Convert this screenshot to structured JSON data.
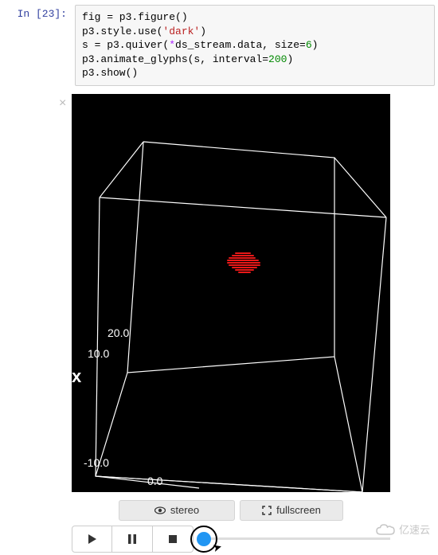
{
  "cell": {
    "prompt": "In [23]:",
    "code": {
      "line1": "fig = p3.figure()",
      "line2a": "p3.style.use(",
      "line2str": "'dark'",
      "line2b": ")",
      "line3a": "s = p3.quiver(",
      "line3op": "*",
      "line3b": "ds_stream.data, size=",
      "line3num": "6",
      "line3c": ")",
      "line4a": "p3.animate_glyphs(s, interval=",
      "line4num": "200",
      "line4b": ")",
      "line5": "p3.show()"
    }
  },
  "output": {
    "close": "×",
    "axis": {
      "x_label": "x",
      "tick_20": "20.0",
      "tick_10": "10.0",
      "tick_m10": "-10.0",
      "tick_0": "0.0"
    },
    "buttons": {
      "stereo": "stereo",
      "fullscreen": "fullscreen"
    },
    "icons": {
      "eye": "eye-icon",
      "expand": "expand-icon",
      "play": "play-icon",
      "pause": "pause-icon",
      "stop": "stop-icon"
    }
  },
  "watermark": {
    "text": "亿速云"
  }
}
